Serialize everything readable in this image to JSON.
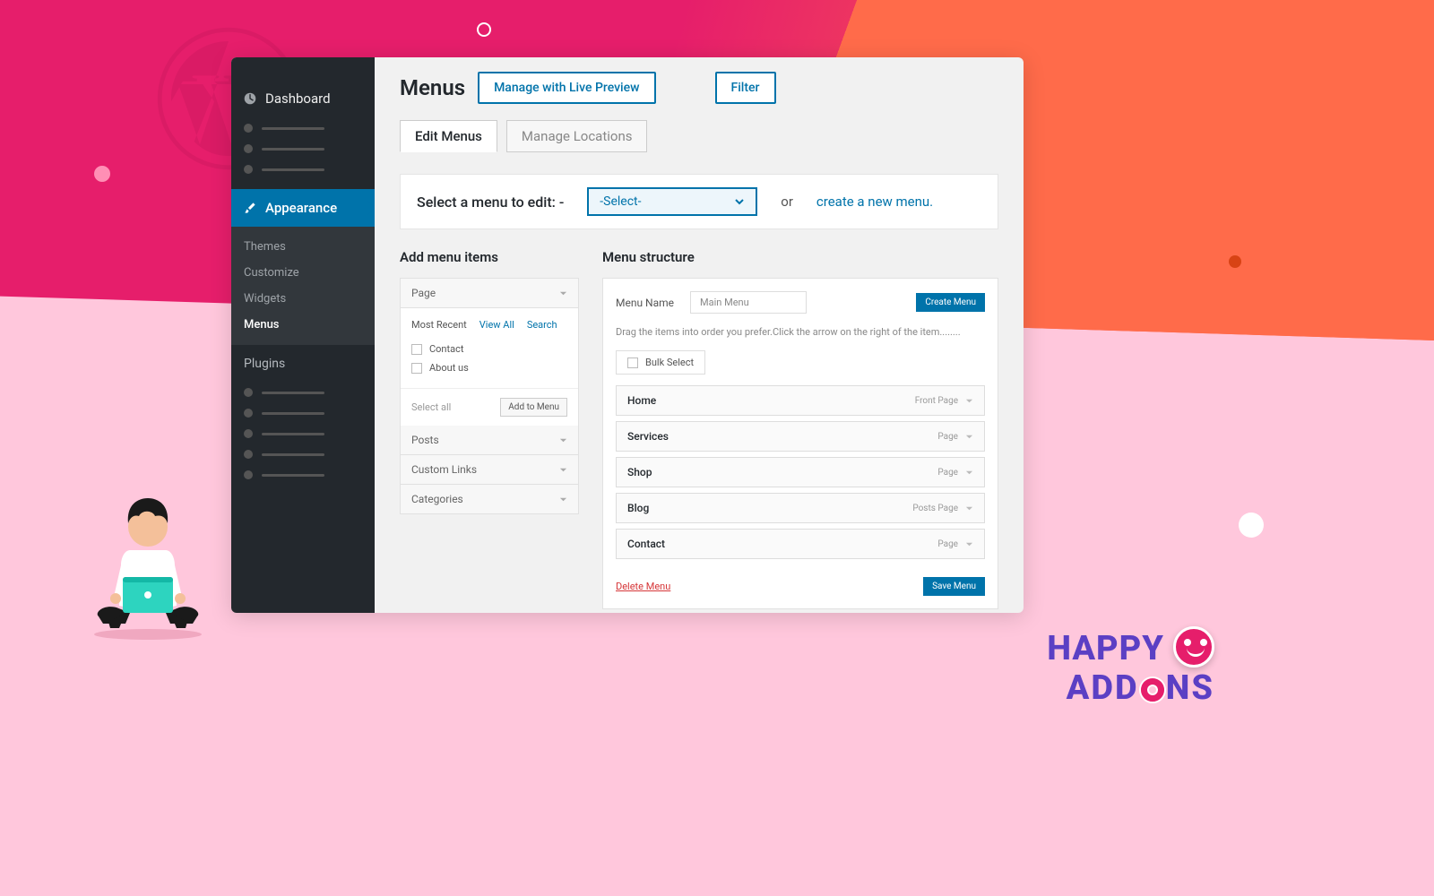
{
  "sidebar": {
    "dashboard": "Dashboard",
    "appearance": "Appearance",
    "submenu": {
      "themes": "Themes",
      "customize": "Customize",
      "widgets": "Widgets",
      "menus": "Menus"
    },
    "plugins": "Plugins"
  },
  "header": {
    "title": "Menus",
    "live_preview": "Manage with Live Preview",
    "filter": "Filter"
  },
  "tabs": {
    "edit": "Edit Menus",
    "locations": "Manage Locations"
  },
  "select_bar": {
    "label": "Select a menu to edit: -",
    "placeholder": "-Select-",
    "or": "or",
    "create": "create a new menu."
  },
  "add_items": {
    "title": "Add menu items",
    "page": "Page",
    "posts": "Posts",
    "custom_links": "Custom Links",
    "categories": "Categories",
    "tabs": {
      "recent": "Most Recent",
      "view_all": "View All",
      "search": "Search"
    },
    "items": {
      "contact": "Contact",
      "about": "About us"
    },
    "select_all": "Select all",
    "add_btn": "Add to Menu"
  },
  "structure": {
    "title": "Menu structure",
    "name_label": "Menu Name",
    "name_value": "Main Menu",
    "create_btn": "Create Menu",
    "hint": "Drag the items into order  you prefer.Click the arrow on the right of the item........",
    "bulk": "Bulk Select",
    "items": [
      {
        "label": "Home",
        "type": "Front Page"
      },
      {
        "label": "Services",
        "type": "Page"
      },
      {
        "label": "Shop",
        "type": "Page"
      },
      {
        "label": "Blog",
        "type": "Posts Page"
      },
      {
        "label": "Contact",
        "type": "Page"
      }
    ],
    "delete": "Delete Menu",
    "save": "Save Menu"
  },
  "logo": {
    "happy": "HAPPY",
    "addons1": "ADD",
    "addons2": "NS"
  }
}
